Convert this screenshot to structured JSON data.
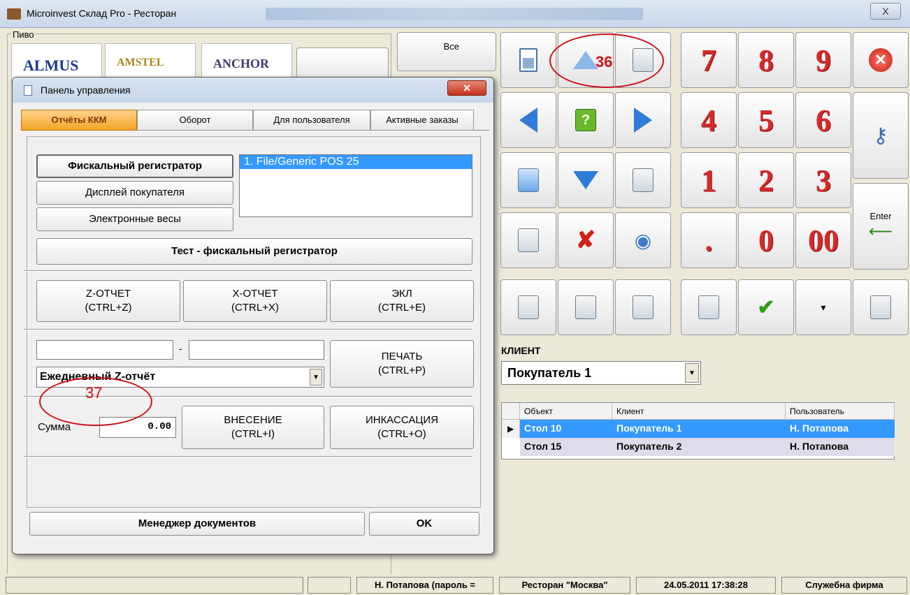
{
  "window": {
    "title": "Microinvest Склад Pro - Ресторан",
    "close_label": "X"
  },
  "group": {
    "legend": "Пиво"
  },
  "logos": [
    "ALMUS",
    "AMSTEL",
    "ANCHOR"
  ],
  "buttons": {
    "all_label": "Все"
  },
  "keypad": {
    "digits": [
      "7",
      "8",
      "9",
      "4",
      "5",
      "6",
      "1",
      "2",
      "3",
      ".",
      "0",
      "00"
    ],
    "enter_label": "Enter"
  },
  "client": {
    "label": "КЛИЕНТ",
    "selected": "Покупатель 1"
  },
  "orders_table": {
    "headers": [
      "Объект",
      "Клиент",
      "Пользователь"
    ],
    "rows": [
      {
        "object": "Стол 10",
        "client": "Покупатель 1",
        "user": "Н. Потапова"
      },
      {
        "object": "Стол 15",
        "client": "Покупатель 2",
        "user": "Н. Потапова"
      }
    ]
  },
  "dialog": {
    "title": "Панель управления",
    "tabs": [
      "Отчёты ККМ",
      "Оборот",
      "Для пользователя",
      "Активные заказы"
    ],
    "devices": [
      "Фискальный регистратор",
      "Дисплей покупателя",
      "Электронные весы"
    ],
    "device_list": [
      "1.  File/Generic POS 25"
    ],
    "test_label": "Тест - фискальный регистратор",
    "z_report": {
      "line1": "Z-ОТЧЕТ",
      "line2": "(CTRL+Z)"
    },
    "x_report": {
      "line1": "X-ОТЧЕТ",
      "line2": "(CTRL+X)"
    },
    "ekl": {
      "line1": "ЭКЛ",
      "line2": "(CTRL+E)"
    },
    "range_sep": "-",
    "report_type": "Ежедневный Z-отчёт",
    "print": {
      "line1": "ПЕЧАТЬ",
      "line2": "(CTRL+P)"
    },
    "sum_label": "Сумма",
    "sum_value": "0.00",
    "deposit": {
      "line1": "ВНЕСЕНИЕ",
      "line2": "(CTRL+I)"
    },
    "withdraw": {
      "line1": "ИНКАССАЦИЯ",
      "line2": "(CTRL+O)"
    },
    "doc_manager": "Менеджер документов",
    "ok": "OK"
  },
  "status": {
    "user": "Н. Потапова  (пароль =",
    "place": "Ресторан \"Москва\"",
    "datetime": "24.05.2011 17:38:28",
    "company": "Служебна фирма"
  },
  "callouts": [
    "36",
    "37"
  ]
}
